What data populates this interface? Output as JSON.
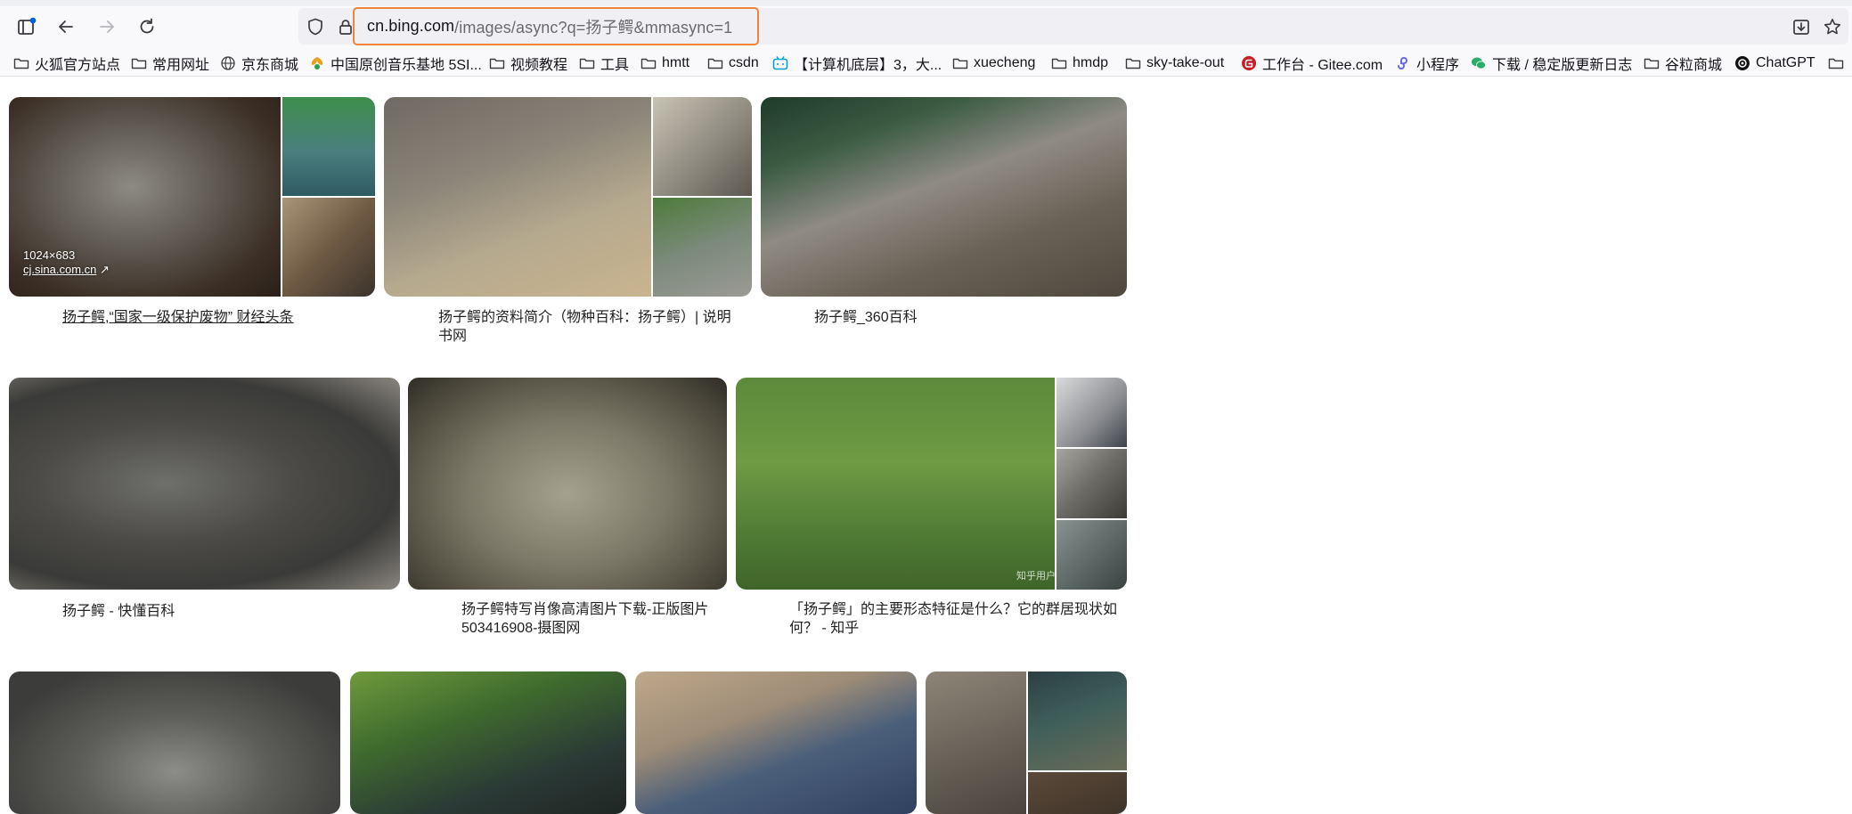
{
  "browser": {
    "url_host": "cn.bing.com",
    "url_path": "/images/async?q=扬子鳄&mmasync=1"
  },
  "bookmarks": [
    {
      "label": "火狐官方站点",
      "icon": "folder-icon"
    },
    {
      "label": "常用网址",
      "icon": "folder-icon"
    },
    {
      "label": "京东商城",
      "icon": "globe-icon"
    },
    {
      "label": "中国原创音乐基地 5SI...",
      "icon": "music-site-icon"
    },
    {
      "label": "视频教程",
      "icon": "folder-icon"
    },
    {
      "label": "工具",
      "icon": "folder-icon"
    },
    {
      "label": "hmtt",
      "icon": "folder-icon"
    },
    {
      "label": "csdn",
      "icon": "folder-icon"
    },
    {
      "label": "【计算机底层】3，大...",
      "icon": "bilibili-icon"
    },
    {
      "label": "xuecheng",
      "icon": "folder-icon"
    },
    {
      "label": "hmdp",
      "icon": "folder-icon"
    },
    {
      "label": "sky-take-out",
      "icon": "folder-icon"
    },
    {
      "label": "工作台 - Gitee.com",
      "icon": "gitee-icon"
    },
    {
      "label": "小程序",
      "icon": "miniprogram-icon"
    },
    {
      "label": "下载 / 稳定版更新日志",
      "icon": "wechat-icon"
    },
    {
      "label": "谷粒商城",
      "icon": "folder-icon"
    },
    {
      "label": "ChatGPT",
      "icon": "chatgpt-icon"
    },
    {
      "label": "",
      "icon": "folder-icon"
    }
  ],
  "results": {
    "row1": [
      {
        "caption": "扬子鳄,“国家一级保护废物” 财经头条",
        "dimensions": "1024×683",
        "source": "cj.sina.com.cn"
      },
      {
        "caption": "扬子鳄的资料简介（物种百科：扬子鳄）| 说明书网"
      },
      {
        "caption": "扬子鳄_360百科"
      }
    ],
    "row2": [
      {
        "caption": "扬子鳄 - 快懂百科"
      },
      {
        "caption": "扬子鳄特写肖像高清图片下载-正版图片503416908-摄图网"
      },
      {
        "caption": "「扬子鳄」的主要形态特征是什么？它的群居现状如何？ - 知乎",
        "watermark": "知乎用户"
      }
    ]
  },
  "colors": {
    "url_focus": "#f0843a",
    "toolbar_bg": "#f9f9fb"
  }
}
